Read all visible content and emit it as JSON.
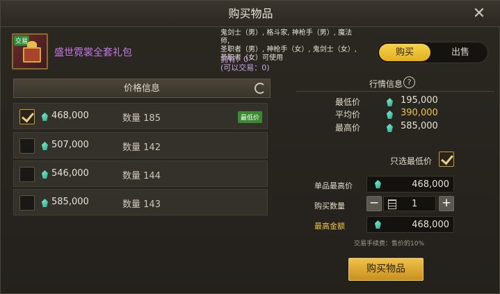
{
  "dialog": {
    "title": "购买物品",
    "close_icon": "close-icon"
  },
  "item": {
    "badge": "交易",
    "name": "盛世霓裳全套礼包",
    "desc_lines": [
      "鬼剑士（男）, 格斗家, 神枪手（男）, 魔法师,",
      "圣职者（男）, 神枪手（女）, 鬼剑士（女）,",
      "圣职者（女）可使用"
    ],
    "owned": "拥有：0",
    "tradable": "(可以交易：0)"
  },
  "mode": {
    "buy": "购买",
    "sell": "出售",
    "selected": "buy"
  },
  "price_list": {
    "header": "价格信息",
    "qty_label": "数量",
    "lowest_badge": "最低价",
    "rows": [
      {
        "price": "468,000",
        "qty": "185",
        "checked": true,
        "lowest": true
      },
      {
        "price": "507,000",
        "qty": "142",
        "checked": false,
        "lowest": false
      },
      {
        "price": "546,000",
        "qty": "144",
        "checked": false,
        "lowest": false
      },
      {
        "price": "585,000",
        "qty": "143",
        "checked": false,
        "lowest": false
      }
    ]
  },
  "market": {
    "title": "行情信息",
    "help": "?",
    "min_label": "最低价",
    "min_value": "195,000",
    "avg_label": "平均价",
    "avg_value": "390,000",
    "max_label": "最高价",
    "max_value": "585,000"
  },
  "form": {
    "only_lowest": "只选最低价",
    "unit_max_label": "单品最高价",
    "unit_max_value": "468,000",
    "qty_label": "购买数量",
    "qty_value": "1",
    "minus": "−",
    "plus": "+",
    "total_label": "最高金额",
    "total_value": "468,000",
    "fee_note": "交易手续费：售价的10%",
    "buy_button": "购买物品"
  }
}
